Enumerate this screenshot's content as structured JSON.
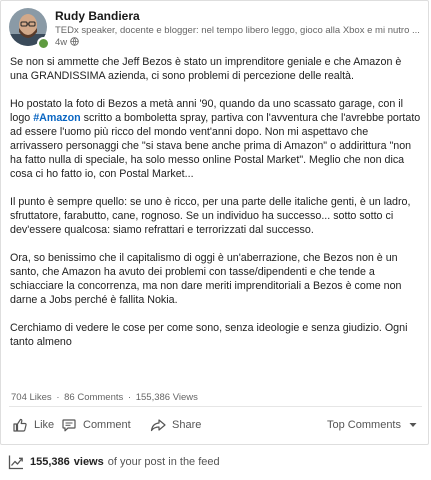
{
  "author": {
    "name": "Rudy Bandiera",
    "headline": "TEDx speaker, docente e blogger: nel tempo libero leggo, gioco alla Xbox e mi nutro ...",
    "age": "4w",
    "online": true
  },
  "post": {
    "p1": "Se non si ammette che Jeff Bezos è stato un imprenditore geniale e che Amazon è una GRANDISSIMA azienda, ci sono problemi di percezione delle realtà.",
    "p2_before": "Ho postato la foto di Bezos a metà anni '90, quando da uno scassato garage, con il logo ",
    "p2_hashtag": "#Amazon",
    "p2_after": " scritto a bomboletta spray, partiva con l'avventura che l'avrebbe portato ad essere l'uomo più ricco del mondo vent'anni dopo. Non mi aspettavo che arrivassero personaggi che \"si stava bene anche prima di Amazon\" o addirittura \"non ha fatto nulla di speciale, ha solo messo online Postal Market\". Meglio che non dica cosa ci ho fatto io, con Postal Market...",
    "p3": "Il punto è sempre quello: se uno è ricco, per una parte delle italiche genti, è un ladro, sfruttatore, farabutto, cane, rognoso. Se un individuo ha successo... sotto sotto ci dev'essere qualcosa: siamo refrattari e terrorizzati dal successo.",
    "p4": "Ora, so benissimo che il capitalismo di oggi è un'aberrazione, che Bezos non è un santo, che Amazon ha avuto dei problemi con tasse/dipendenti e che tende a schiacciare la concorrenza, ma non dare meriti imprenditoriali a Bezos è come non darne a Jobs perché è fallita Nokia.",
    "p5": "Cerchiamo di vedere le cose per come sono, senza ideologie e senza giudizio. Ogni tanto almeno"
  },
  "stats": {
    "likes": "704 Likes",
    "comments": "86 Comments",
    "views": "155,386 Views",
    "separator": "·"
  },
  "actions": {
    "like": "Like",
    "comment": "Comment",
    "share": "Share",
    "sort": "Top Comments"
  },
  "footer": {
    "views_number": "155,386",
    "views_word": "views",
    "rest": "of your post in the feed"
  },
  "colors": {
    "hashtag": "#0a66c2",
    "online": "#5f9b41"
  },
  "icons": [
    "globe-icon",
    "like-icon",
    "comment-icon",
    "share-icon",
    "chevron-down-icon",
    "trending-icon"
  ]
}
